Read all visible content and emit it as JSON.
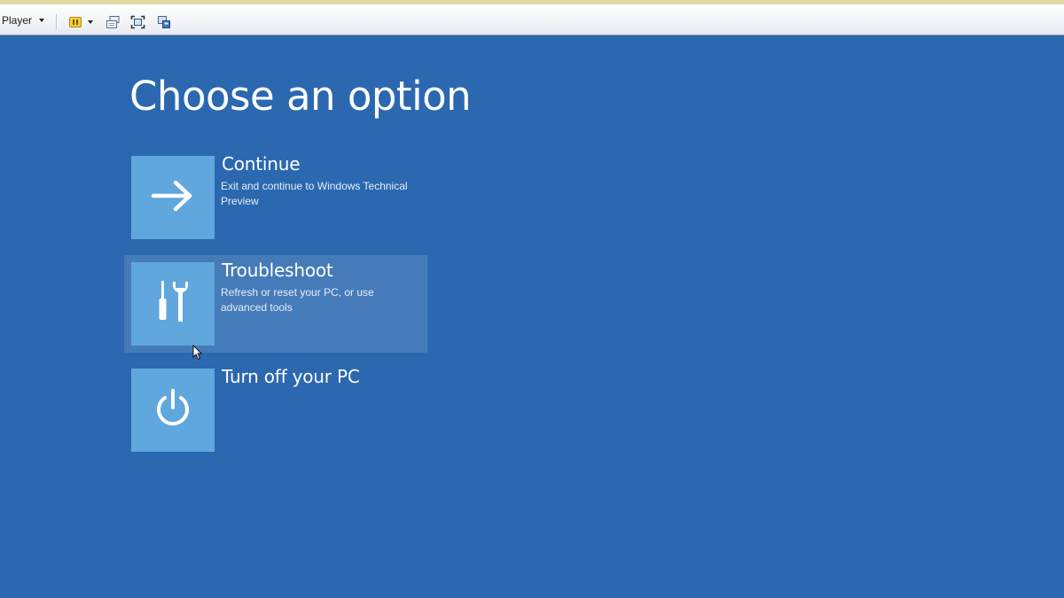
{
  "toolbar": {
    "player_label": "Player",
    "icons": [
      "pause-icon",
      "send-ctrl-alt-del-icon",
      "full-screen-icon",
      "unity-icon"
    ],
    "accent_color": "#e3d9a6"
  },
  "screen": {
    "background_color": "#2b68b0",
    "tile_color": "#5fa7dd",
    "title": "Choose an option",
    "options": [
      {
        "title": "Continue",
        "description": "Exit and continue to Windows Technical Preview",
        "icon": "arrow-right-icon"
      },
      {
        "title": "Troubleshoot",
        "description": "Refresh or reset your PC, or use advanced tools",
        "icon": "tools-icon",
        "highlighted": true
      },
      {
        "title": "Turn off your PC",
        "description": "",
        "icon": "power-icon"
      }
    ]
  }
}
